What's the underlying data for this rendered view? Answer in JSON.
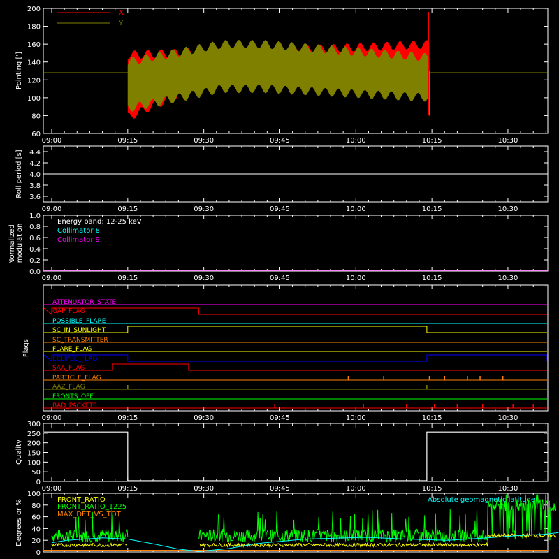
{
  "colors": {
    "background": "#000000",
    "foreground": "#ffffff",
    "red": "#ff0000",
    "olive": "#808000",
    "cyan": "#00ffff",
    "magenta": "#ff00ff",
    "orange": "#ff8000",
    "yellow": "#ffff00",
    "blue": "#0000ff",
    "green": "#00ff00"
  },
  "chart_data": [
    {
      "id": "pointing",
      "type": "line",
      "ylabel": "Pointing [']",
      "ylim": [
        60,
        200
      ],
      "yticks": [
        60,
        80,
        100,
        120,
        140,
        160,
        180,
        200
      ],
      "x_range_minutes": [
        0,
        100
      ],
      "x_tick_labels": [
        "09:00",
        "09:15",
        "09:30",
        "09:45",
        "10:00",
        "10:15",
        "10:30"
      ],
      "legend": [
        {
          "name": "X",
          "color": "red"
        },
        {
          "name": "Y",
          "color": "olive"
        }
      ],
      "series": [
        {
          "name": "X",
          "color": "red",
          "baseline": 128,
          "active_start": "09:15",
          "active_end": "10:14",
          "envelope_start": [
            78,
            148
          ],
          "envelope_mid": [
            125,
            152
          ],
          "envelope_end": [
            110,
            160
          ]
        },
        {
          "name": "Y",
          "color": "olive",
          "baseline": 128,
          "active_start": "09:15",
          "active_end": "10:14",
          "envelope_start": [
            88,
            140
          ],
          "envelope_mid": [
            110,
            160
          ],
          "envelope_end": [
            100,
            145
          ]
        }
      ]
    },
    {
      "id": "roll",
      "type": "line",
      "ylabel": "Roll period [s]",
      "ylim": [
        3.5,
        4.5
      ],
      "yticks": [
        3.6,
        3.8,
        4.0,
        4.2,
        4.4
      ],
      "series": [
        {
          "name": "Roll period",
          "color": "foreground",
          "value": 4.0
        }
      ]
    },
    {
      "id": "modulation",
      "type": "line",
      "ylabel": "Normalized modulation",
      "ylim": [
        0,
        1
      ],
      "yticks": [
        0.0,
        0.2,
        0.4,
        0.6,
        0.8,
        1.0
      ],
      "legend": [
        {
          "name": "Energy band: 12-25 keV",
          "color": "foreground"
        },
        {
          "name": "Collimator 8",
          "color": "cyan"
        },
        {
          "name": "Collimator 9",
          "color": "magenta"
        }
      ],
      "series": [
        {
          "name": "Collimator 9",
          "color": "magenta",
          "value": 0.0
        }
      ]
    },
    {
      "id": "flags",
      "type": "line",
      "ylabel": "Flags",
      "rows": [
        {
          "name": "ATTENUATOR_STATE",
          "color": "magenta",
          "high": []
        },
        {
          "name": "GAP_FLAG",
          "color": "red",
          "high": [
            [
              0,
              29
            ]
          ]
        },
        {
          "name": "POSSIBLE_FLARE",
          "color": "cyan",
          "high": []
        },
        {
          "name": "SC_IN_SUNLIGHT",
          "color": "yellow",
          "high": [
            [
              15,
              74
            ]
          ]
        },
        {
          "name": "SC_TRANSMITTER",
          "color": "orange",
          "high": []
        },
        {
          "name": "FLARE_FLAG",
          "color": "yellow",
          "high": []
        },
        {
          "name": "ECLIPSE_FLAG",
          "color": "blue",
          "high": [
            [
              0,
              15
            ],
            [
              74,
              100
            ]
          ]
        },
        {
          "name": "SAA_FLAG",
          "color": "red",
          "high": [
            [
              12,
              27
            ]
          ]
        },
        {
          "name": "PARTICLE_FLAG",
          "color": "orange",
          "spikes": [
            58.5,
            65.5,
            74.5,
            77.5,
            82,
            84.5,
            89
          ]
        },
        {
          "name": "AAZ_FLAG",
          "color": "olive",
          "spikes": [
            15,
            74
          ]
        },
        {
          "name": "FRONTS_OFF",
          "color": "green",
          "high": []
        },
        {
          "name": "BAD_PACKETS",
          "color": "red",
          "spikes": [
            44,
            61.5,
            70,
            75.5,
            80,
            85,
            91,
            95
          ]
        }
      ]
    },
    {
      "id": "quality",
      "type": "line",
      "ylabel": "Quality",
      "ylim": [
        0,
        300
      ],
      "yticks": [
        0,
        50,
        100,
        150,
        200,
        250,
        300
      ],
      "series": [
        {
          "name": "Quality",
          "color": "foreground",
          "value": 256,
          "low": [
            [
              15,
              74
            ]
          ]
        }
      ]
    },
    {
      "id": "ratios",
      "type": "line",
      "ylabel": "Degrees or %",
      "ylim": [
        0,
        100
      ],
      "yticks": [
        0,
        20,
        40,
        60,
        80,
        100
      ],
      "legend": [
        {
          "name": "FRONT_RATIO",
          "color": "yellow"
        },
        {
          "name": "FRONT_RATIO_1225",
          "color": "green"
        },
        {
          "name": "MAX_DET_VS_TOT",
          "color": "orange"
        },
        {
          "name": "Absolute geomagnetic latitude",
          "color": "cyan"
        }
      ],
      "series": [
        {
          "name": "Absolute geomagnetic latitude",
          "color": "cyan",
          "x": [
            0,
            3,
            10,
            15,
            20,
            25,
            29,
            35,
            40,
            50,
            62,
            70,
            78,
            86,
            92,
            97,
            100
          ],
          "y": [
            16,
            20,
            24,
            22,
            14,
            5,
            1,
            6,
            14,
            22,
            25,
            22,
            20,
            24,
            28,
            30,
            33
          ]
        },
        {
          "name": "FRONT_RATIO_1225",
          "color": "green",
          "gaps": [
            [
              15,
              29
            ]
          ],
          "level": 28,
          "high_from": 86,
          "high_level": 80
        },
        {
          "name": "FRONT_RATIO",
          "color": "yellow",
          "gaps": [
            [
              15,
              29
            ]
          ],
          "level": 12
        },
        {
          "name": "MAX_DET_VS_TOT",
          "color": "orange",
          "level": 3
        }
      ]
    }
  ]
}
